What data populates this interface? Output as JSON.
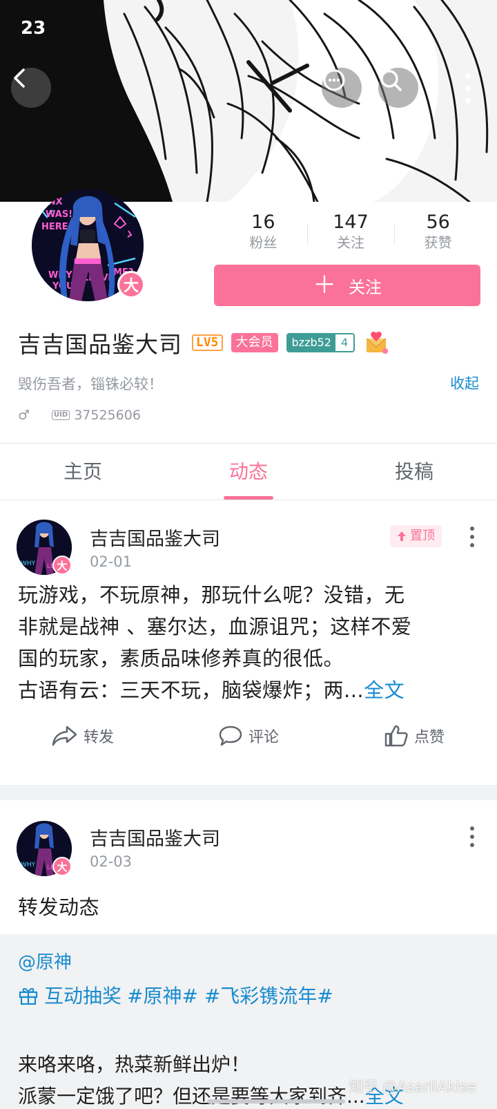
{
  "status_bar": {
    "time": "23"
  },
  "header": {
    "icons": [
      "back-icon",
      "chat-icon",
      "search-icon",
      "more-icon"
    ]
  },
  "profile": {
    "avatar_badge": "大",
    "stats": [
      {
        "value": "16",
        "label": "粉丝"
      },
      {
        "value": "147",
        "label": "关注"
      },
      {
        "value": "56",
        "label": "获赞"
      }
    ],
    "follow_label": "关注",
    "follow_plus": "＋",
    "username": "吉吉国品鉴大司",
    "level": "LV5",
    "vip_label": "大会员",
    "fan_medal": {
      "name": "bzzb52",
      "level": "4"
    },
    "signature": "毁伤吾者，锱铢必较！",
    "collapse_label": "收起",
    "gender_symbol": "♂",
    "uid_tag": "UID",
    "uid": "37525606"
  },
  "tabs": [
    {
      "label": "主页",
      "active": false
    },
    {
      "label": "动态",
      "active": true
    },
    {
      "label": "投稿",
      "active": false
    }
  ],
  "posts": [
    {
      "author": "吉吉国品鉴大司",
      "date": "02-01",
      "pinned_label": "置顶",
      "text_lines": [
        "玩游戏，不玩原神，那玩什么呢？没错，无",
        "非就是战神 、塞尔达，血源诅咒；这样不爱",
        "国的玩家，素质品味修养真的很低。",
        "古语有云：三天不玩，脑袋爆炸；两..."
      ],
      "full_text_label": "全文",
      "actions": {
        "forward": "转发",
        "comment": "评论",
        "like": "点赞"
      }
    },
    {
      "author": "吉吉国品鉴大司",
      "date": "02-03",
      "text": "转发动态",
      "repost": {
        "at_user": "@原神",
        "lottery_label": "互动抽奖",
        "hashtags": "#原神# #飞彩镌流年#",
        "lines": [
          "来咯来咯，热菜新鲜出炉！",
          "派蒙一定饿了吧？但还是要等大家到齐..."
        ],
        "full_text_label": "全文"
      }
    }
  ],
  "watermark": "知乎 @AsarliAkise",
  "colors": {
    "brand_pink": "#fb7299",
    "link_blue": "#178bcf",
    "medal_teal": "#3e9c96",
    "level_orange": "#ff8a00"
  }
}
